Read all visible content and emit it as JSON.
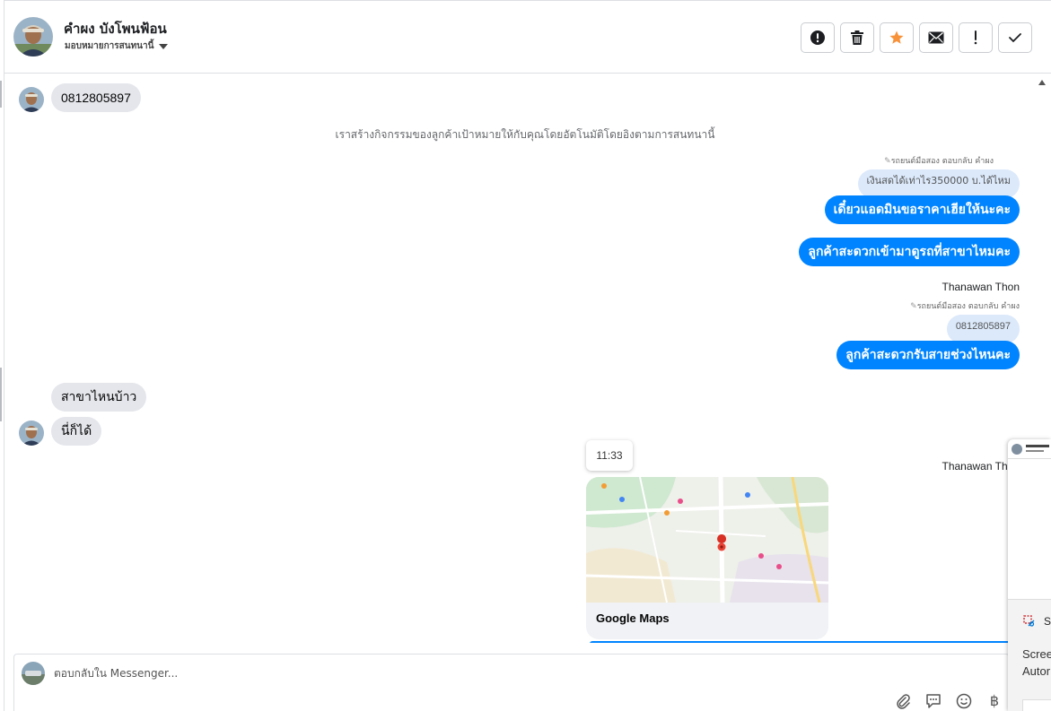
{
  "header": {
    "contact_name": "คำผง บังโพนฟ้อน",
    "assign_label": "มอบหมายการสนทนานี้",
    "tool_icons": [
      "alert-circle-icon",
      "trash-icon",
      "star-icon",
      "envelope-icon",
      "exclamation-icon",
      "checkmark-icon"
    ]
  },
  "thread": {
    "system_note": "เราสร้างกิจกรรมของลูกค้าเป้าหมายให้กับคุณโดยอัตโนมัติโดยอิงตามการสนทนานี้",
    "messages": {
      "incoming_phone": "0812805897",
      "reply_note_1": "รถยนต์มือสอง ตอบกลับ คำผง",
      "reply_quote_1": "เงินสดได้เท่าไร350000 บ.ได้ไหม",
      "out_1": "เดี๋ยวแอดมินขอราคาเฮียให้นะคะ",
      "out_2": "ลูกค้าสะดวกเข้ามาดูรถที่สาขาไหมคะ",
      "sender_1": "Thanawan Thon",
      "reply_note_2": "รถยนต์มือสอง ตอบกลับ คำผง",
      "reply_quote_2": "0812805897",
      "out_3": "ลูกค้าสะดวกรับสายช่วงไหนคะ",
      "in_1": "สาขาไหนบ้าว",
      "in_2": "นี่ก็ได้",
      "tooltip_time": "11:33",
      "sender_2": "Thanawan Thon",
      "map_card_title": "Google Maps"
    },
    "accent_blue": "#0084ff",
    "incoming_gray": "#e4e6eb"
  },
  "composer": {
    "placeholder": "ตอบกลับใน Messenger...",
    "icons": [
      "paperclip-icon",
      "saved-reply-icon",
      "emoji-icon",
      "baht-icon"
    ]
  },
  "overlay": {
    "title": "S",
    "line_1": "Scree",
    "line_2": "Autor"
  }
}
